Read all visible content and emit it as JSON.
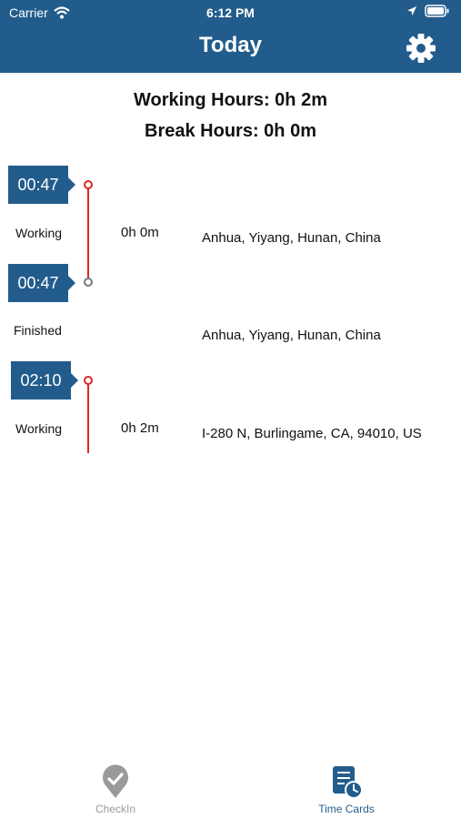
{
  "status_bar": {
    "carrier": "Carrier",
    "time": "6:12 PM"
  },
  "header": {
    "title": "Today",
    "settings_icon": "gear-icon"
  },
  "summary": {
    "working_hours": "Working Hours: 0h 2m",
    "break_hours": "Break Hours: 0h 0m"
  },
  "entries": [
    {
      "time": "00:47",
      "status": "Working",
      "duration": "0h 0m",
      "location": "Anhua, Yiyang, Hunan, China"
    },
    {
      "time": "00:47",
      "status": "Finished",
      "duration": "",
      "location": "Anhua, Yiyang, Hunan, China"
    },
    {
      "time": "02:10",
      "status": "Working",
      "duration": "0h 2m",
      "location": "I-280 N, Burlingame, CA, 94010, US"
    }
  ],
  "tabs": [
    {
      "label": "CheckIn",
      "icon": "checkin-pin-icon",
      "active": false
    },
    {
      "label": "Time Cards",
      "icon": "time-cards-icon",
      "active": true
    }
  ],
  "colors": {
    "primary": "#225c8c",
    "accent_line": "#e02424",
    "inactive": "#9a9a9a"
  }
}
